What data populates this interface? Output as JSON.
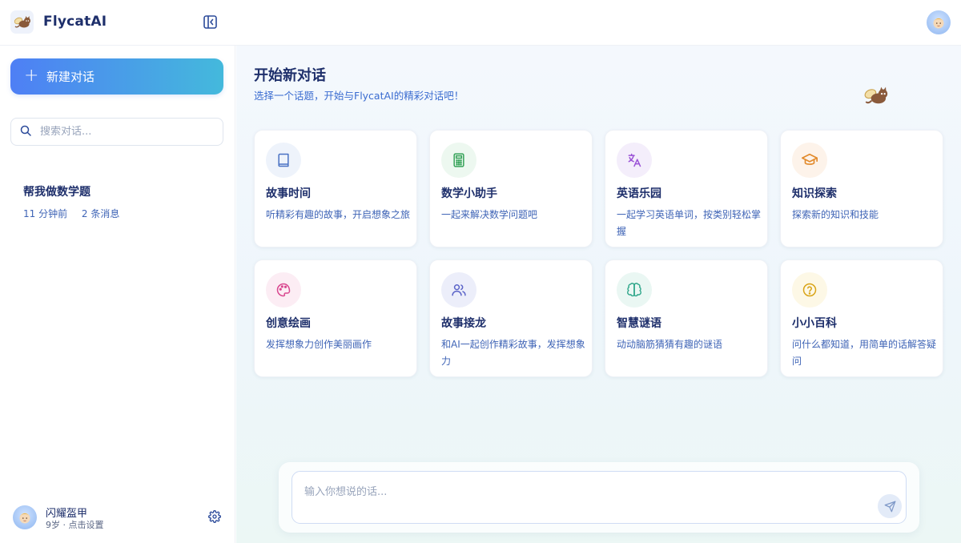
{
  "app": {
    "name": "FlycatAI"
  },
  "sidebar": {
    "new_chat_label": "新建对话",
    "search_placeholder": "搜索对话...",
    "conversations": [
      {
        "title": "帮我做数学题",
        "time": "11 分钟前",
        "messages": "2 条消息"
      }
    ],
    "user": {
      "name": "闪耀盔甲",
      "subtitle": "9岁 · 点击设置"
    }
  },
  "main": {
    "title": "开始新对话",
    "subtitle": "选择一个话题，开始与FlycatAI的精彩对话吧！",
    "topics": [
      {
        "title": "故事时间",
        "desc": "听精彩有趣的故事，开启想象之旅",
        "icon": "book-icon",
        "color": "#4a72c4"
      },
      {
        "title": "数学小助手",
        "desc": "一起来解决数学问题吧",
        "icon": "calculator-icon",
        "color": "#37a35a"
      },
      {
        "title": "英语乐园",
        "desc": "一起学习英语单词，按类别轻松掌握",
        "icon": "translate-icon",
        "color": "#9a52d6"
      },
      {
        "title": "知识探索",
        "desc": "探索新的知识和技能",
        "icon": "graduation-cap-icon",
        "color": "#e28a2b"
      },
      {
        "title": "创意绘画",
        "desc": "发挥想象力创作美丽画作",
        "icon": "palette-icon",
        "color": "#d9478f"
      },
      {
        "title": "故事接龙",
        "desc": "和AI一起创作精彩故事，发挥想象力",
        "icon": "users-icon",
        "color": "#5b64c8"
      },
      {
        "title": "智慧谜语",
        "desc": "动动脑筋猜猜有趣的谜语",
        "icon": "brain-icon",
        "color": "#2ea68a"
      },
      {
        "title": "小小百科",
        "desc": "问什么都知道，用简单的话解答疑问",
        "icon": "question-icon",
        "color": "#d9a417"
      }
    ]
  },
  "composer": {
    "placeholder": "输入你想说的话..."
  }
}
